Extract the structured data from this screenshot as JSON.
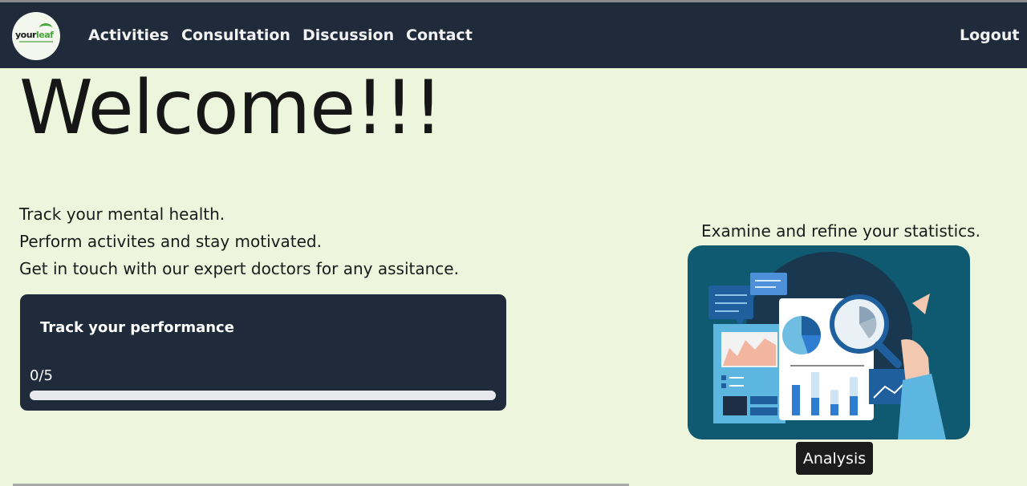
{
  "nav": {
    "logo_text_main": "your",
    "logo_text_accent": "leaf",
    "links": [
      "Activities",
      "Consultation",
      "Discussion",
      "Contact"
    ],
    "logout": "Logout"
  },
  "hero": {
    "title": "Welcome!!!",
    "lines": [
      "Track your mental health.",
      "Perform activites and stay motivated.",
      "Get in touch with our expert doctors for any assitance."
    ]
  },
  "performance": {
    "title": "Track your performance",
    "count_text": "0/5",
    "progress_fraction": 0
  },
  "stats": {
    "caption": "Examine and refine your statistics.",
    "tooltip": "Analysis"
  },
  "colors": {
    "page_bg": "#edf5dd",
    "navbar_bg": "#1f2a3b",
    "brand_green": "#46a33e",
    "illustration_bg": "#0f5a70"
  },
  "icons": [
    "leaf-logo-icon",
    "analysis-illustration"
  ]
}
